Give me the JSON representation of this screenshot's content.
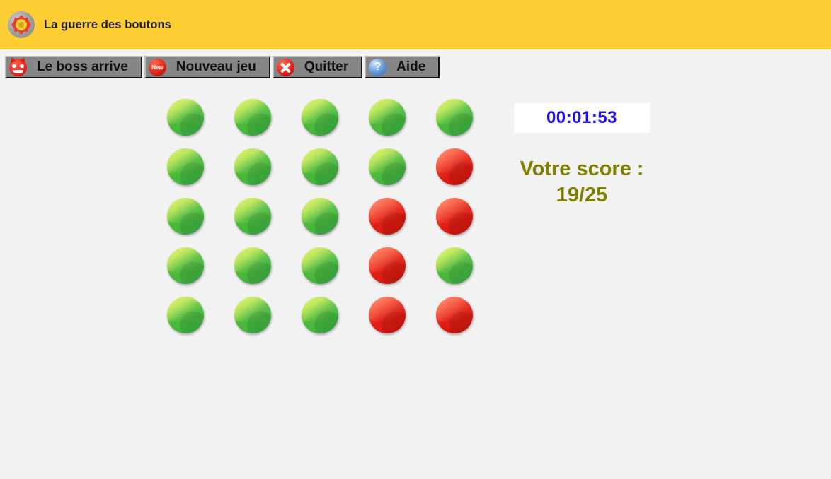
{
  "window": {
    "title": "La guerre des boutons",
    "icon": "target-icon",
    "titlebar_color": "#fdcd31",
    "background_color": "#f2f2f2"
  },
  "toolbar": {
    "buttons": [
      {
        "label": "Le boss arrive",
        "icon": "devil-smiley-icon"
      },
      {
        "label": "Nouveau jeu",
        "icon": "new-badge-icon",
        "icon_text": "New"
      },
      {
        "label": "Quitter",
        "icon": "close-x-icon"
      },
      {
        "label": "Aide",
        "icon": "help-question-icon",
        "icon_text": "?"
      }
    ]
  },
  "board": {
    "rows": 5,
    "cols": 5,
    "green_color": "#49bb38",
    "red_color": "#e42a18",
    "cells": [
      [
        "green",
        "green",
        "green",
        "green",
        "green"
      ],
      [
        "green",
        "green",
        "green",
        "green",
        "red"
      ],
      [
        "green",
        "green",
        "green",
        "red",
        "red"
      ],
      [
        "green",
        "green",
        "green",
        "red",
        "green"
      ],
      [
        "green",
        "green",
        "green",
        "red",
        "red"
      ]
    ]
  },
  "panel": {
    "timer": "00:01:53",
    "timer_text_color": "#1a12f0",
    "score_label": "Votre score :",
    "score_value": "19/25",
    "score_text_color": "#827f00"
  }
}
